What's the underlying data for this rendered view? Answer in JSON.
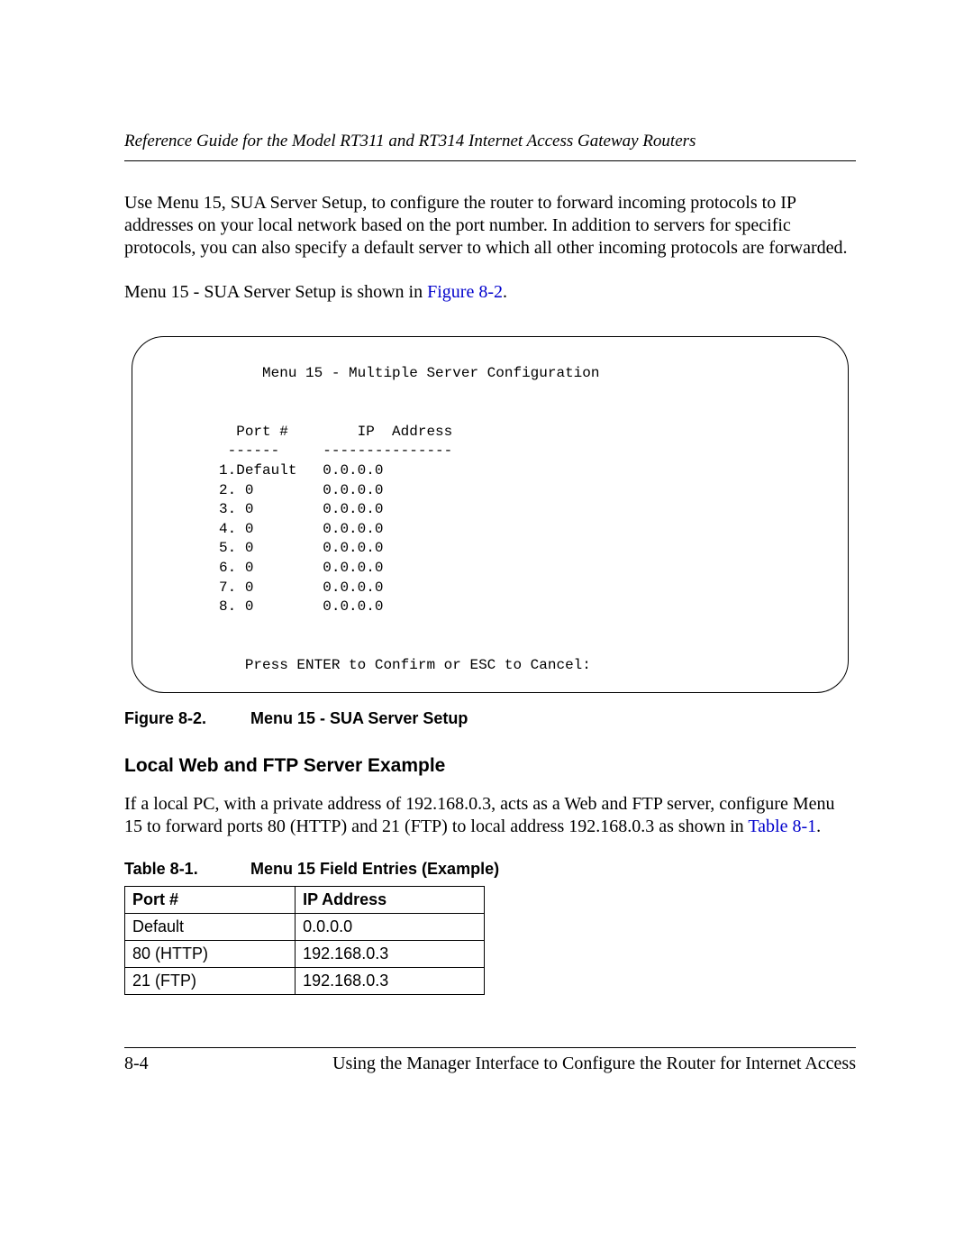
{
  "header": {
    "running_title": "Reference Guide for the Model RT311 and RT314 Internet Access Gateway Routers"
  },
  "paras": {
    "intro": "Use Menu 15, SUA Server Setup, to configure the router to forward incoming protocols to IP addresses on your local network based on the port number. In addition to servers for specific protocols, you can also specify a default server to which all other incoming protocols are forwarded.",
    "lead_in_pre": "Menu 15 - SUA Server Setup is shown in ",
    "lead_in_link": "Figure 8-2",
    "lead_in_post": "."
  },
  "figure": {
    "title": "Menu 15 - Multiple Server Configuration",
    "col1": "Port #",
    "col2": "IP  Address",
    "rows": [
      {
        "port": "1.Default",
        "ip": "0.0.0.0"
      },
      {
        "port": "2. 0",
        "ip": "0.0.0.0"
      },
      {
        "port": "3. 0",
        "ip": "0.0.0.0"
      },
      {
        "port": "4. 0",
        "ip": "0.0.0.0"
      },
      {
        "port": "5. 0",
        "ip": "0.0.0.0"
      },
      {
        "port": "6. 0",
        "ip": "0.0.0.0"
      },
      {
        "port": "7. 0",
        "ip": "0.0.0.0"
      },
      {
        "port": "8. 0",
        "ip": "0.0.0.0"
      }
    ],
    "footer": "Press ENTER to Confirm or ESC to Cancel:",
    "caption_num": "Figure 8-2.",
    "caption_text": "Menu 15 - SUA Server Setup"
  },
  "section": {
    "heading": "Local Web and FTP Server Example",
    "para_pre": "If a local PC, with a private address of 192.168.0.3, acts as a Web and FTP server, configure Menu 15 to forward ports 80 (HTTP) and 21 (FTP) to local address 192.168.0.3 as shown in ",
    "para_link": "Table 8-1",
    "para_post": "."
  },
  "table": {
    "caption_num": "Table 8-1.",
    "caption_text": "Menu 15 Field Entries (Example)",
    "headers": [
      "Port #",
      "IP Address"
    ],
    "rows": [
      {
        "port": "Default",
        "ip": "0.0.0.0"
      },
      {
        "port": "80 (HTTP)",
        "ip": "192.168.0.3"
      },
      {
        "port": "21 (FTP)",
        "ip": "192.168.0.3"
      }
    ]
  },
  "footer": {
    "page_num": "8-4",
    "chapter": "Using the Manager Interface to Configure the Router for Internet Access"
  }
}
